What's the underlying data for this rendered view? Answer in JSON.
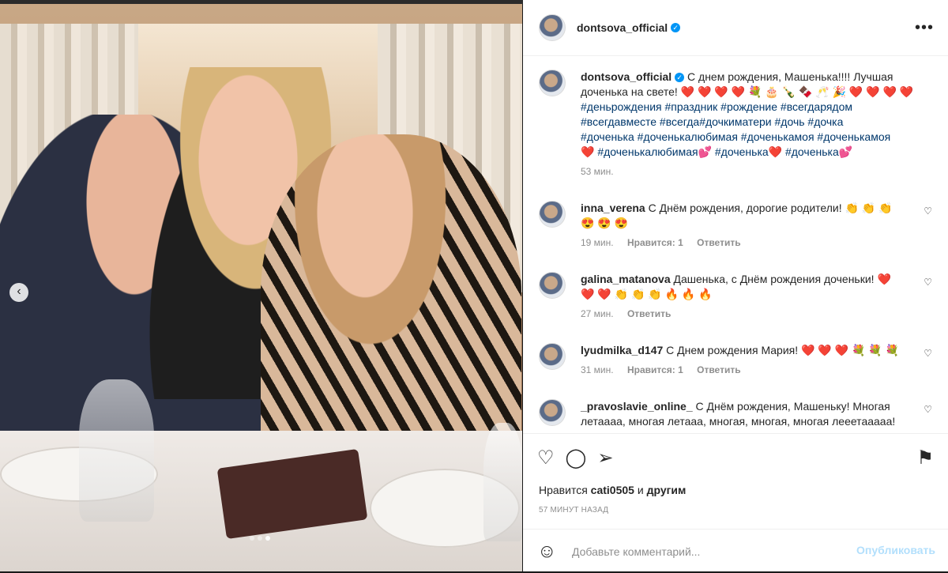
{
  "post": {
    "username": "dontsova_official",
    "more_label": "•••",
    "caption_lines": [
      "С днем рождения, Машенька!!!! Лучшая",
      "доченька на свете! ❤️ ❤️ ❤️ ❤️ 💐 🎂 🍾 🍫 🥂 🎉 ❤️ ❤️ ❤️ ❤️"
    ],
    "hashtags": [
      "#деньрождения #праздник #рождение #всегдарядом",
      "#всегдавместе #всегда#дочкиматери #дочь #дочка",
      "#доченька #доченькалюбимая #доченькамоя #доченькамоя",
      "❤️ #доченькалюбимая💕 #доченька❤️ #доченька💕"
    ],
    "caption_time": "53 мин."
  },
  "comments": [
    {
      "username": "inna_verena",
      "text": "С Днём рождения, дорогие родители! 👏 👏 👏",
      "text2": "😍 😍 😍",
      "time": "19 мин.",
      "likes": "Нравится: 1",
      "reply": "Ответить"
    },
    {
      "username": "galina_matanova",
      "text": "Дашенька, с Днём рождения доченьки! ❤️",
      "text2": "❤️ ❤️ 👏 👏 👏 🔥 🔥 🔥",
      "time": "27 мин.",
      "reply": "Ответить"
    },
    {
      "username": "lyudmilka_d147",
      "text": "С Днем рождения Мария! ❤️ ❤️ ❤️ 💐 💐 💐",
      "time": "31 мин.",
      "likes": "Нравится: 1",
      "reply": "Ответить"
    },
    {
      "username": "_pravoslavie_online_",
      "text": "С Днём рождения, Машеньку! Многая",
      "text2": "летаааа, многая летааа, многая, многая, многая лееетааааа!"
    }
  ],
  "actions": {
    "likes_prefix": "Нравится",
    "likes_user": "cati0505",
    "likes_and": "и",
    "likes_others": "другим",
    "post_time": "57 МИНУТ НАЗАД",
    "comment_placeholder": "Добавьте комментарий...",
    "publish_label": "Опубликовать"
  },
  "icons": {
    "like": "heart-icon",
    "comment": "comment-icon",
    "share": "share-icon",
    "save": "bookmark-icon",
    "emoji": "smiley-icon",
    "prev": "chevron-left-icon"
  },
  "colors": {
    "link": "#00376b",
    "verified": "#0095f6",
    "publish_disabled": "#b2dffc",
    "meta": "#8e8e8e"
  },
  "carousel": {
    "count": 3,
    "active": 3
  }
}
